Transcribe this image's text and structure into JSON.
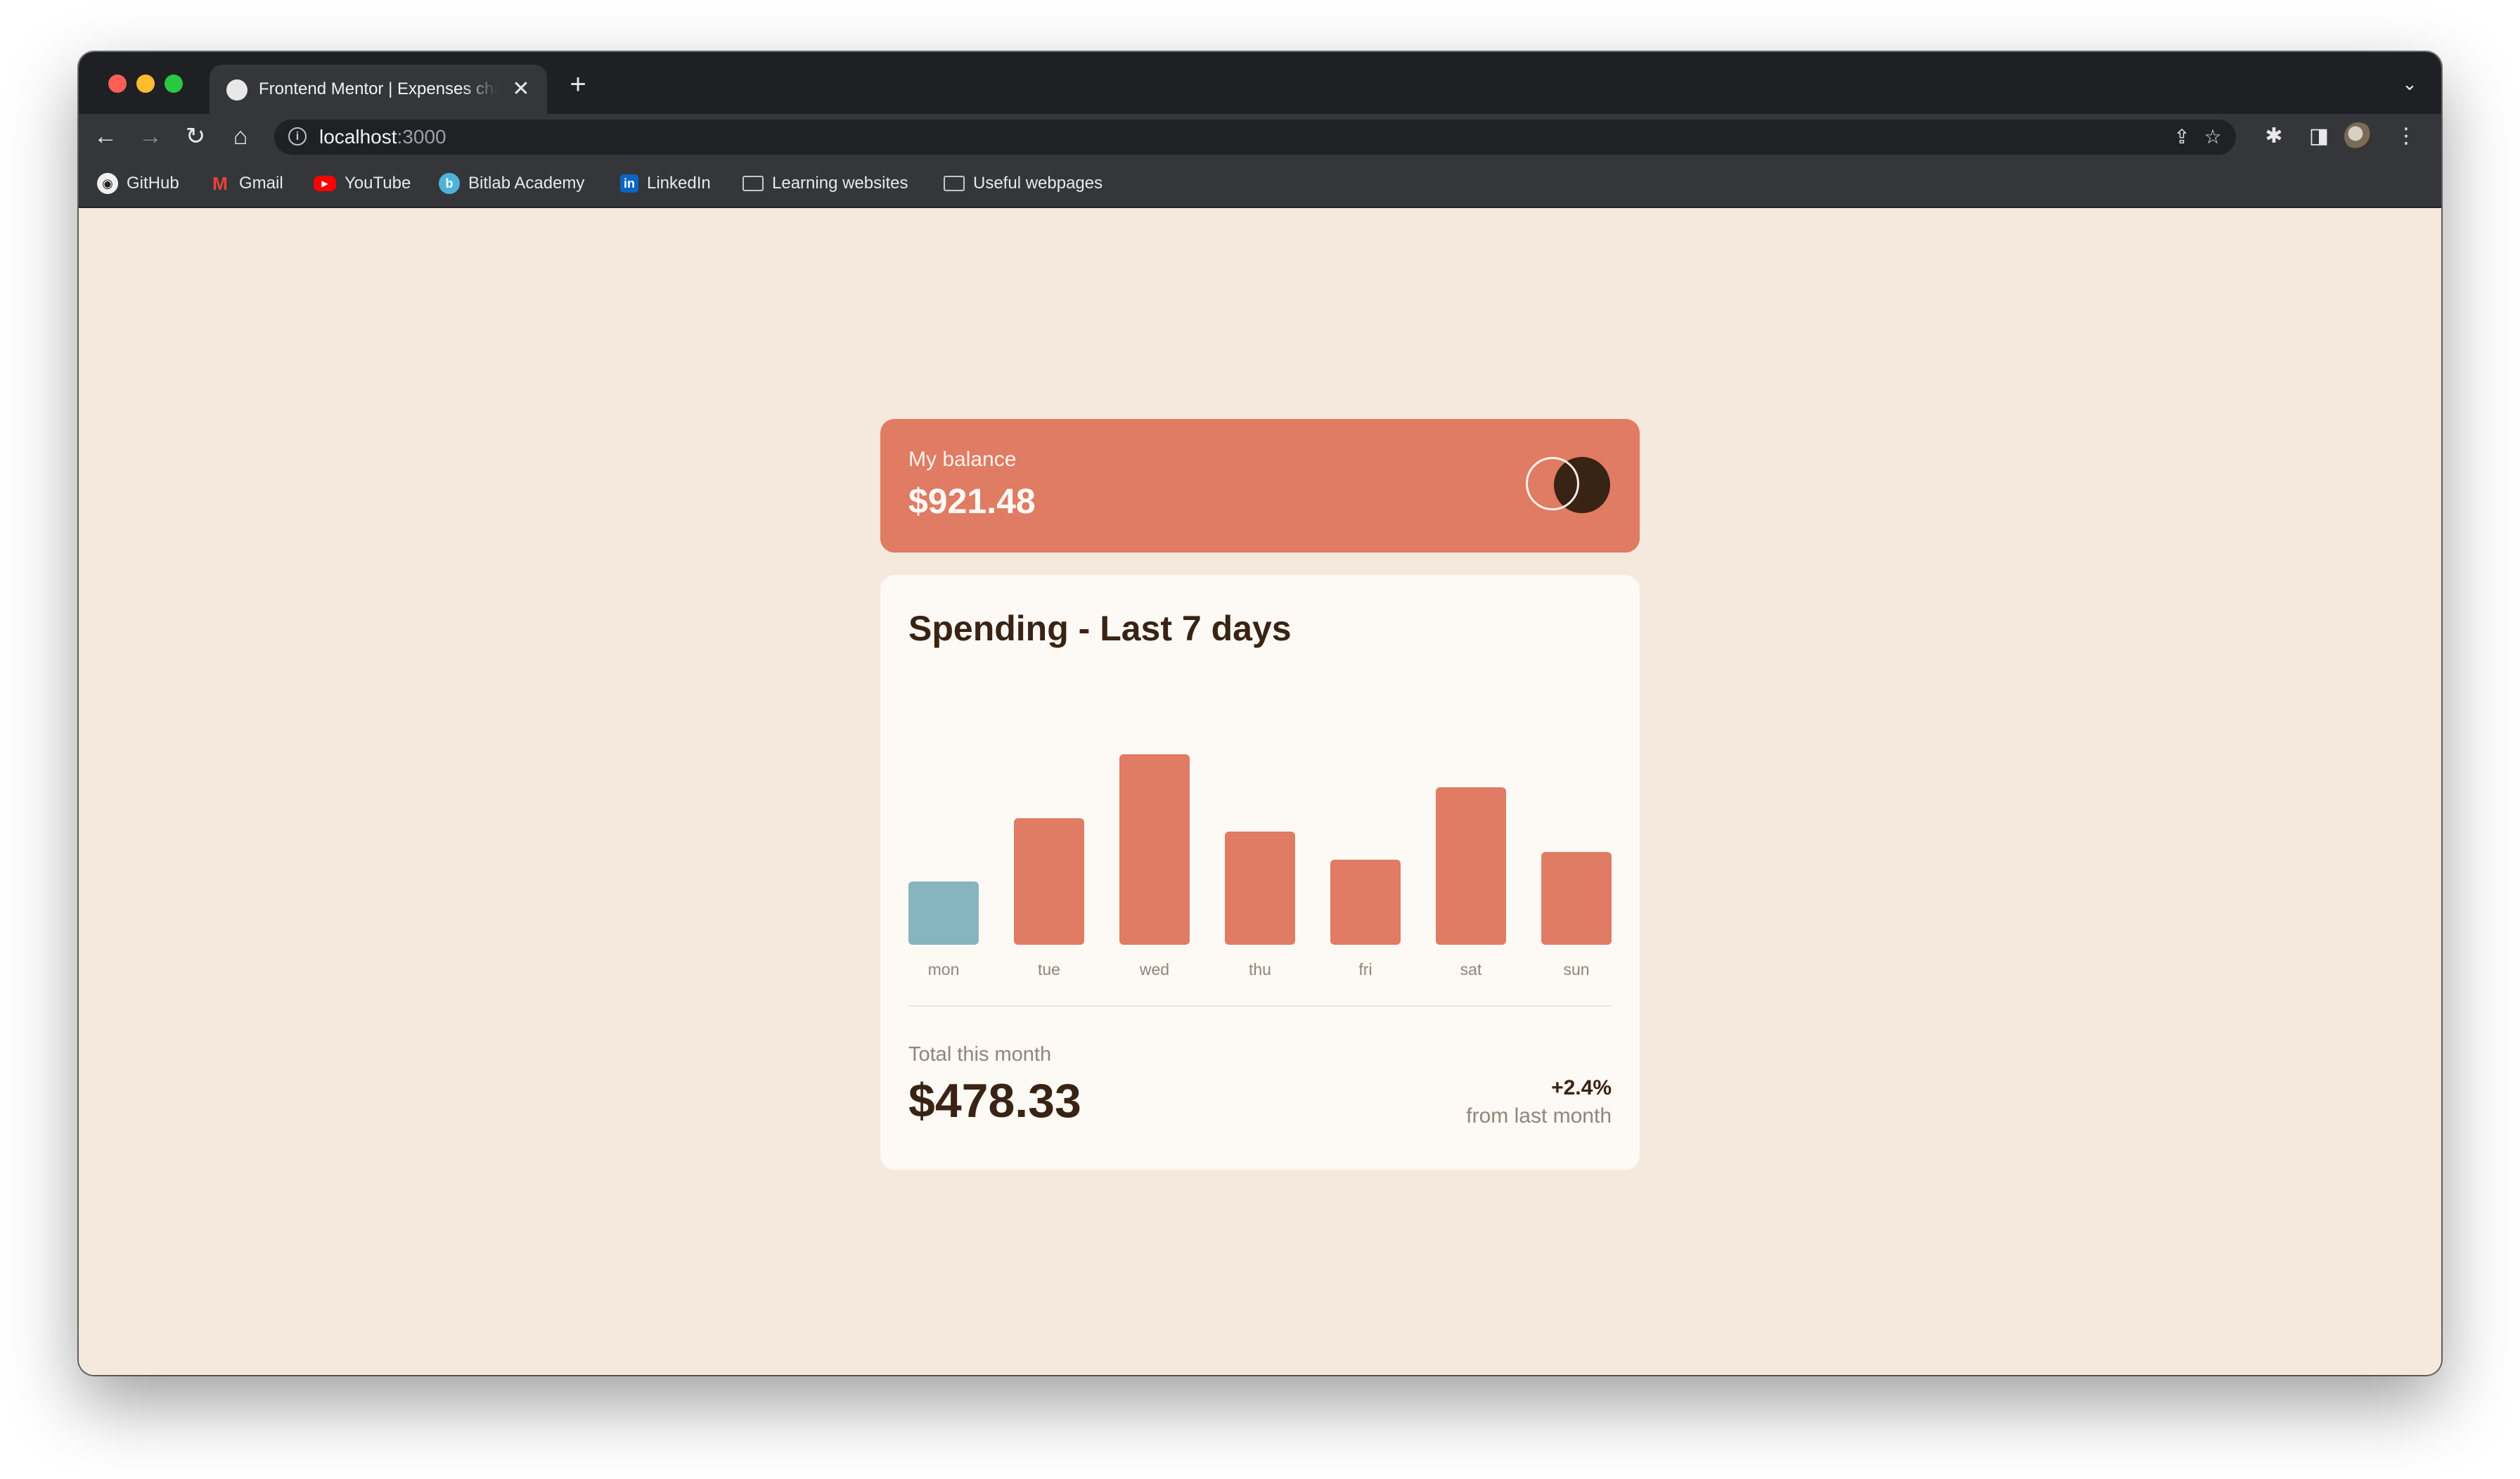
{
  "browser": {
    "tab_title": "Frontend Mentor | Expenses chart component",
    "tab_close_icon": "✕",
    "new_tab_icon": "+",
    "tab_search_icon": "⌄",
    "back_icon": "←",
    "forward_icon": "→",
    "reload_icon": "↻",
    "home_icon": "⌂",
    "info_icon": "i",
    "url_host": "localhost",
    "url_port": ":3000",
    "share_icon": "⇪",
    "bookmark_star_icon": "☆",
    "extensions_icon": "✱",
    "sidepanel_icon": "◨",
    "menu_icon": "⋮"
  },
  "bookmarks": [
    {
      "label": "GitHub",
      "icon": "github-icon"
    },
    {
      "label": "Gmail",
      "icon": "gmail-icon"
    },
    {
      "label": "YouTube",
      "icon": "youtube-icon"
    },
    {
      "label": "Bitlab Academy",
      "icon": "bitlab-icon"
    },
    {
      "label": "LinkedIn",
      "icon": "linkedin-icon"
    },
    {
      "label": "Learning websites",
      "icon": "folder-icon"
    },
    {
      "label": "Useful webpages",
      "icon": "folder-icon"
    }
  ],
  "balance": {
    "label": "My balance",
    "value": "$921.48"
  },
  "spending": {
    "title": "Spending - Last 7 days",
    "total_label": "Total this month",
    "total_value": "$478.33",
    "change_value": "+2.4%",
    "change_label": "from last month"
  },
  "colors": {
    "accent": "#e07b64",
    "current_day": "#86b4bf",
    "background": "#f5e8dc",
    "card": "#fdf9f4",
    "dark_text": "#382314",
    "muted_text": "#92857a"
  },
  "chart_data": {
    "type": "bar",
    "categories": [
      "mon",
      "tue",
      "wed",
      "thu",
      "fri",
      "sat",
      "sun"
    ],
    "values": [
      17.45,
      34.91,
      52.36,
      31.07,
      23.39,
      43.28,
      25.48
    ],
    "highlight_index": 0,
    "ylim": [
      0,
      60
    ]
  }
}
